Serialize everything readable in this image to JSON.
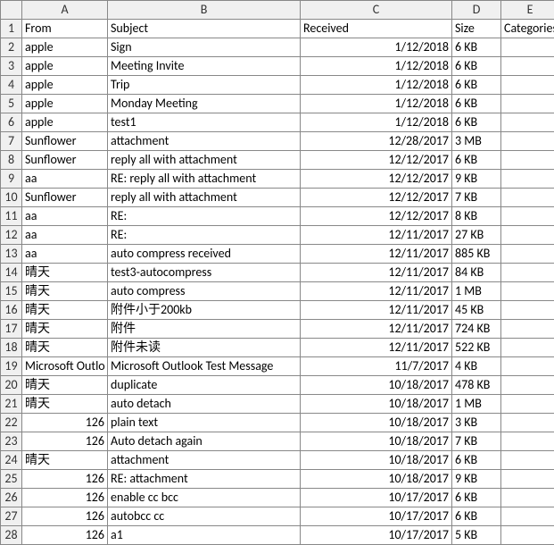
{
  "columns": [
    "A",
    "B",
    "C",
    "D",
    "E"
  ],
  "headers": {
    "from": "From",
    "subject": "Subject",
    "received": "Received",
    "size": "Size",
    "categories": "Categories"
  },
  "rows": [
    {
      "n": "1",
      "from": "From",
      "subject": "Subject",
      "received": "Received",
      "size": "Size",
      "e": "Categories",
      "fromNum": false,
      "recNum": false
    },
    {
      "n": "2",
      "from": "apple",
      "subject": "Sign",
      "received": "1/12/2018",
      "size": "6 KB",
      "e": "",
      "fromNum": false,
      "recNum": true
    },
    {
      "n": "3",
      "from": "apple",
      "subject": "Meeting Invite",
      "received": "1/12/2018",
      "size": "6 KB",
      "e": "",
      "fromNum": false,
      "recNum": true
    },
    {
      "n": "4",
      "from": "apple",
      "subject": "Trip",
      "received": "1/12/2018",
      "size": "6 KB",
      "e": "",
      "fromNum": false,
      "recNum": true
    },
    {
      "n": "5",
      "from": "apple",
      "subject": "Monday Meeting",
      "received": "1/12/2018",
      "size": "6 KB",
      "e": "",
      "fromNum": false,
      "recNum": true
    },
    {
      "n": "6",
      "from": "apple",
      "subject": "test1",
      "received": "1/12/2018",
      "size": "6 KB",
      "e": "",
      "fromNum": false,
      "recNum": true
    },
    {
      "n": "7",
      "from": "Sunflower",
      "subject": "attachment",
      "received": "12/28/2017",
      "size": "3 MB",
      "e": "",
      "fromNum": false,
      "recNum": true
    },
    {
      "n": "8",
      "from": "Sunflower",
      "subject": "reply all with attachment",
      "received": "12/12/2017",
      "size": "6 KB",
      "e": "",
      "fromNum": false,
      "recNum": true
    },
    {
      "n": "9",
      "from": "aa",
      "subject": "RE: reply all with attachment",
      "received": "12/12/2017",
      "size": "9 KB",
      "e": "",
      "fromNum": false,
      "recNum": true
    },
    {
      "n": "10",
      "from": "Sunflower",
      "subject": "reply all with attachment",
      "received": "12/12/2017",
      "size": "7 KB",
      "e": "",
      "fromNum": false,
      "recNum": true
    },
    {
      "n": "11",
      "from": "aa",
      "subject": "RE:",
      "received": "12/12/2017",
      "size": "8 KB",
      "e": "",
      "fromNum": false,
      "recNum": true
    },
    {
      "n": "12",
      "from": "aa",
      "subject": "RE:",
      "received": "12/11/2017",
      "size": "27 KB",
      "e": "",
      "fromNum": false,
      "recNum": true
    },
    {
      "n": "13",
      "from": "aa",
      "subject": "auto compress received",
      "received": "12/11/2017",
      "size": "885 KB",
      "e": "",
      "fromNum": false,
      "recNum": true
    },
    {
      "n": "14",
      "from": "晴天",
      "subject": "test3-autocompress",
      "received": "12/11/2017",
      "size": "84 KB",
      "e": "",
      "fromNum": false,
      "recNum": true
    },
    {
      "n": "15",
      "from": "晴天",
      "subject": "auto compress",
      "received": "12/11/2017",
      "size": "1 MB",
      "e": "",
      "fromNum": false,
      "recNum": true
    },
    {
      "n": "16",
      "from": "晴天",
      "subject": "附件小于200kb",
      "received": "12/11/2017",
      "size": "45 KB",
      "e": "",
      "fromNum": false,
      "recNum": true
    },
    {
      "n": "17",
      "from": "晴天",
      "subject": "附件",
      "received": "12/11/2017",
      "size": "724 KB",
      "e": "",
      "fromNum": false,
      "recNum": true
    },
    {
      "n": "18",
      "from": "晴天",
      "subject": "附件未读",
      "received": "12/11/2017",
      "size": "522 KB",
      "e": "",
      "fromNum": false,
      "recNum": true
    },
    {
      "n": "19",
      "from": "Microsoft Outlo",
      "subject": "Microsoft Outlook Test Message",
      "received": "11/7/2017",
      "size": "4 KB",
      "e": "",
      "fromNum": false,
      "recNum": true
    },
    {
      "n": "20",
      "from": "晴天",
      "subject": "duplicate",
      "received": "10/18/2017",
      "size": "478 KB",
      "e": "",
      "fromNum": false,
      "recNum": true
    },
    {
      "n": "21",
      "from": "晴天",
      "subject": "auto detach",
      "received": "10/18/2017",
      "size": "1 MB",
      "e": "",
      "fromNum": false,
      "recNum": true
    },
    {
      "n": "22",
      "from": "126",
      "subject": "plain text",
      "received": "10/18/2017",
      "size": "3 KB",
      "e": "",
      "fromNum": true,
      "recNum": true
    },
    {
      "n": "23",
      "from": "126",
      "subject": "Auto detach again",
      "received": "10/18/2017",
      "size": "7 KB",
      "e": "",
      "fromNum": true,
      "recNum": true
    },
    {
      "n": "24",
      "from": "晴天",
      "subject": "attachment",
      "received": "10/18/2017",
      "size": "6 KB",
      "e": "",
      "fromNum": false,
      "recNum": true
    },
    {
      "n": "25",
      "from": "126",
      "subject": "RE: attachment",
      "received": "10/18/2017",
      "size": "9 KB",
      "e": "",
      "fromNum": true,
      "recNum": true
    },
    {
      "n": "26",
      "from": "126",
      "subject": "enable cc bcc",
      "received": "10/17/2017",
      "size": "6 KB",
      "e": "",
      "fromNum": true,
      "recNum": true
    },
    {
      "n": "27",
      "from": "126",
      "subject": "autobcc cc",
      "received": "10/17/2017",
      "size": "6 KB",
      "e": "",
      "fromNum": true,
      "recNum": true
    },
    {
      "n": "28",
      "from": "126",
      "subject": "a1",
      "received": "10/17/2017",
      "size": "5 KB",
      "e": "",
      "fromNum": true,
      "recNum": true
    }
  ]
}
